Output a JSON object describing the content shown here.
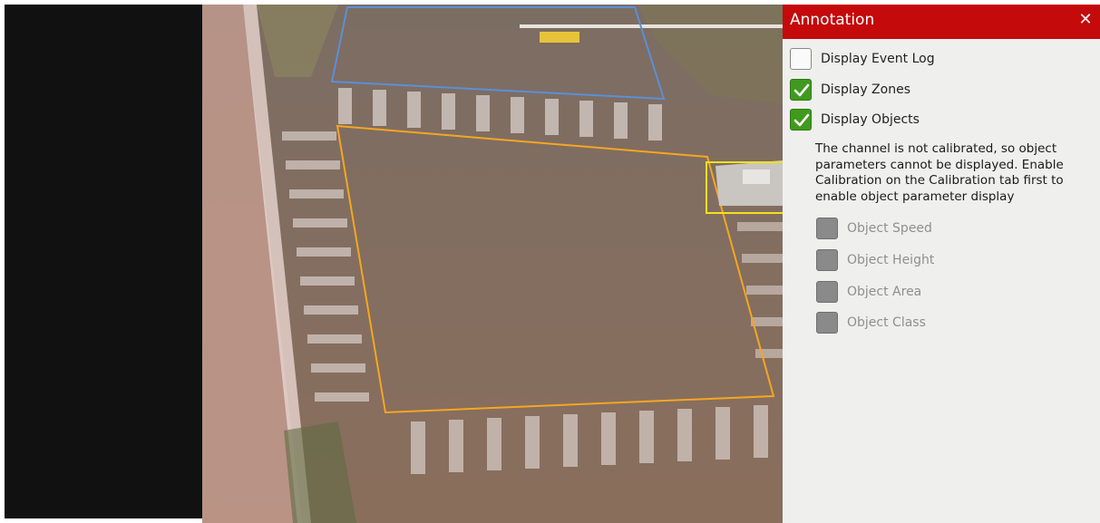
{
  "panel": {
    "title": "Annotation",
    "close_icon": "close-icon",
    "header_color": "#c40a0a"
  },
  "options": {
    "display_event_log": {
      "label": "Display Event Log",
      "checked": false
    },
    "display_zones": {
      "label": "Display Zones",
      "checked": true
    },
    "display_objects": {
      "label": "Display Objects",
      "checked": true
    }
  },
  "calibration_note": "The channel is not calibrated, so object parameters cannot be displayed. Enable Calibration on the Calibration tab first to enable object parameter display",
  "object_params": [
    {
      "label": "Object Speed",
      "enabled": false
    },
    {
      "label": "Object Height",
      "enabled": false
    },
    {
      "label": "Object Area",
      "enabled": false
    },
    {
      "label": "Object Class",
      "enabled": false
    }
  ],
  "zone_colors": {
    "zone_1": "#5b8fd6",
    "zone_2": "#f5a623",
    "object_box": "#f0e020"
  }
}
